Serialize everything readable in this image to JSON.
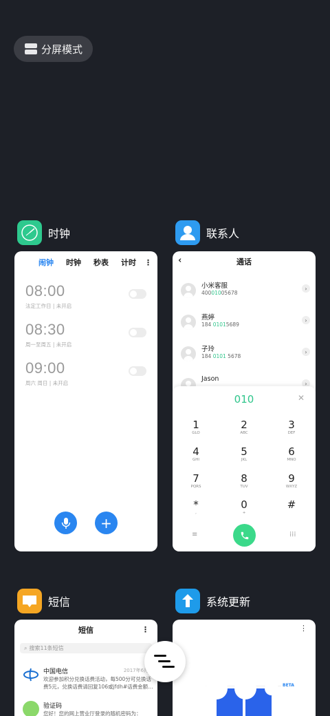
{
  "split_screen": {
    "label": "分屏模式"
  },
  "apps": {
    "clock": {
      "name": "时钟",
      "tabs": [
        "闹钟",
        "时钟",
        "秒表",
        "计时"
      ],
      "alarms": [
        {
          "time": "08:00",
          "desc": "法定工作日 | 未开启"
        },
        {
          "time": "08:30",
          "desc": "周一至周五 | 未开启"
        },
        {
          "time": "09:00",
          "desc": "周六 周日 | 未开启"
        }
      ]
    },
    "contacts": {
      "name": "联系人",
      "header": "通话",
      "list": [
        {
          "name": "小米客服",
          "num_pre": "400",
          "num_hl": "010",
          "num_post": "05678"
        },
        {
          "name": "燕婷",
          "num_pre": "184 ",
          "num_hl": "0101",
          "num_post": "5689"
        },
        {
          "name": "子玲",
          "num_pre": "184 ",
          "num_hl": "0101",
          "num_post": " 5678"
        },
        {
          "name": "Jason",
          "num_pre": "",
          "num_hl": "",
          "num_post": ""
        }
      ],
      "dial_input": "010",
      "keys": [
        {
          "d": "1",
          "l": "GLO"
        },
        {
          "d": "2",
          "l": "ABC"
        },
        {
          "d": "3",
          "l": "DEF"
        },
        {
          "d": "4",
          "l": "GHI"
        },
        {
          "d": "5",
          "l": "JKL"
        },
        {
          "d": "6",
          "l": "MNO"
        },
        {
          "d": "7",
          "l": "PQRS"
        },
        {
          "d": "8",
          "l": "TUV"
        },
        {
          "d": "9",
          "l": "WXYZ"
        },
        {
          "d": "*",
          "l": ","
        },
        {
          "d": "0",
          "l": "+"
        },
        {
          "d": "#",
          "l": ""
        }
      ]
    },
    "messages": {
      "name": "短信",
      "header": "短信",
      "search_placeholder": "搜索11条短信",
      "items": [
        {
          "from": "中国电信",
          "date": "2017年6月30",
          "text": "欢迎参加积分兑换话费活动，每500分可兑换话费5元，兑换话费请回复106或jfdh#话费金额…"
        },
        {
          "from": "验证码",
          "date": "",
          "text": "您好！您的网上营业厅登录的随机密码为："
        }
      ]
    },
    "updater": {
      "name": "系统更新",
      "beta": "BETA"
    }
  },
  "colors": {
    "background": "#1d2027",
    "accent_blue": "#2a86f0",
    "accent_green": "#2fc58b"
  }
}
